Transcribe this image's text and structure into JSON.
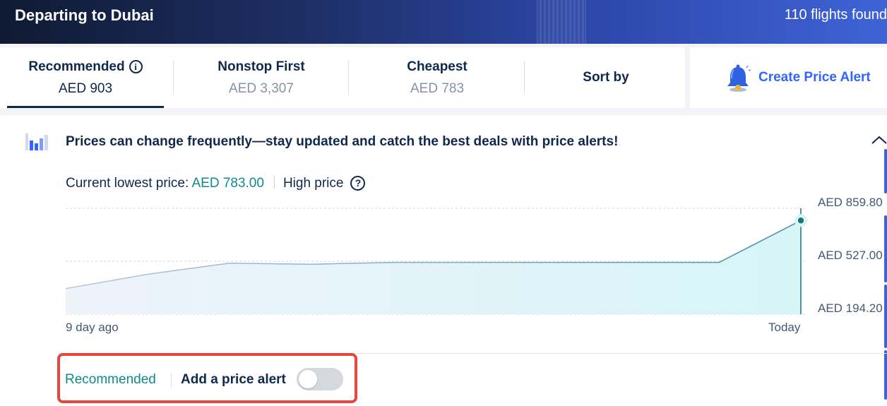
{
  "header": {
    "title": "Departing to Dubai",
    "flights_found": "110 flights found"
  },
  "sort_tabs": [
    {
      "label": "Recommended",
      "price": "AED 903",
      "active": true
    },
    {
      "label": "Nonstop First",
      "price": "AED 3,307",
      "active": false
    },
    {
      "label": "Cheapest",
      "price": "AED 783",
      "active": false
    }
  ],
  "sort_by_label": "Sort by",
  "create_alert_label": "Create Price Alert",
  "price_trend": {
    "headline": "Prices can change frequently—stay updated and catch the best deals with price alerts!",
    "current_lowest_label": "Current lowest price:",
    "current_lowest_value": "AED 783.00",
    "price_level": "High price"
  },
  "chart_data": {
    "type": "area",
    "x_labels": [
      "9 day ago",
      "Today"
    ],
    "x": [
      -9,
      -8,
      -7,
      -6,
      -5,
      -4,
      -3,
      -2,
      -1,
      0
    ],
    "values": [
      355,
      445,
      515,
      508,
      520,
      520,
      520,
      520,
      520,
      783
    ],
    "y_tick_labels": [
      "AED 859.80",
      "AED 527.00",
      "AED 194.20"
    ],
    "y_ticks": [
      859.8,
      527.0,
      194.2
    ],
    "ylim": [
      194.2,
      859.8
    ],
    "colors": {
      "line": "#4a8f9e",
      "fill": "#d6f5f7",
      "marker": "#0f7a80"
    }
  },
  "footer": {
    "recommended_label": "Recommended",
    "add_alert_label": "Add a price alert",
    "toggle_on": false
  },
  "colors": {
    "accent": "#3264ff",
    "teal": "#0f8a8a",
    "highlight": "#e8453c"
  }
}
